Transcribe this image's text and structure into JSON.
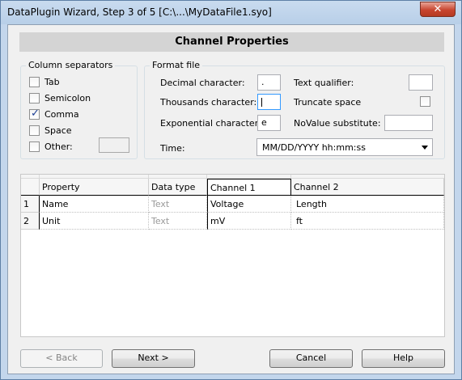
{
  "window": {
    "title": "DataPlugin Wizard, Step 3 of 5 [C:\\...\\MyDataFile1.syo]",
    "close_glyph": "✕"
  },
  "header": {
    "title": "Channel Properties"
  },
  "column_separators": {
    "legend": "Column separators",
    "options": [
      {
        "label": "Tab",
        "checked": false
      },
      {
        "label": "Semicolon",
        "checked": false
      },
      {
        "label": "Comma",
        "checked": true
      },
      {
        "label": "Space",
        "checked": false
      },
      {
        "label": "Other:",
        "checked": false
      }
    ],
    "other_value": ""
  },
  "format_file": {
    "legend": "Format file",
    "decimal_label": "Decimal character:",
    "decimal_value": ".",
    "thousands_label": "Thousands character:",
    "thousands_value": "",
    "exponential_label": "Exponential character:",
    "exponential_value": "e",
    "text_qualifier_label": "Text qualifier:",
    "text_qualifier_value": "",
    "truncate_label": "Truncate space",
    "truncate_checked": false,
    "novalue_label": "NoValue substitute:",
    "novalue_value": "",
    "time_label": "Time:",
    "time_value": "MM/DD/YYYY hh:mm:ss"
  },
  "grid": {
    "columns": [
      "Property",
      "Data type",
      "Channel 1",
      "Channel 2"
    ],
    "rows": [
      {
        "num": "1",
        "cells": [
          "Name",
          "Text",
          "Voltage",
          "Length"
        ]
      },
      {
        "num": "2",
        "cells": [
          "Unit",
          "Text",
          "mV",
          "ft"
        ]
      }
    ]
  },
  "buttons": {
    "back": "< Back",
    "next": "Next >",
    "cancel": "Cancel",
    "help": "Help"
  },
  "check_glyph": "✓"
}
